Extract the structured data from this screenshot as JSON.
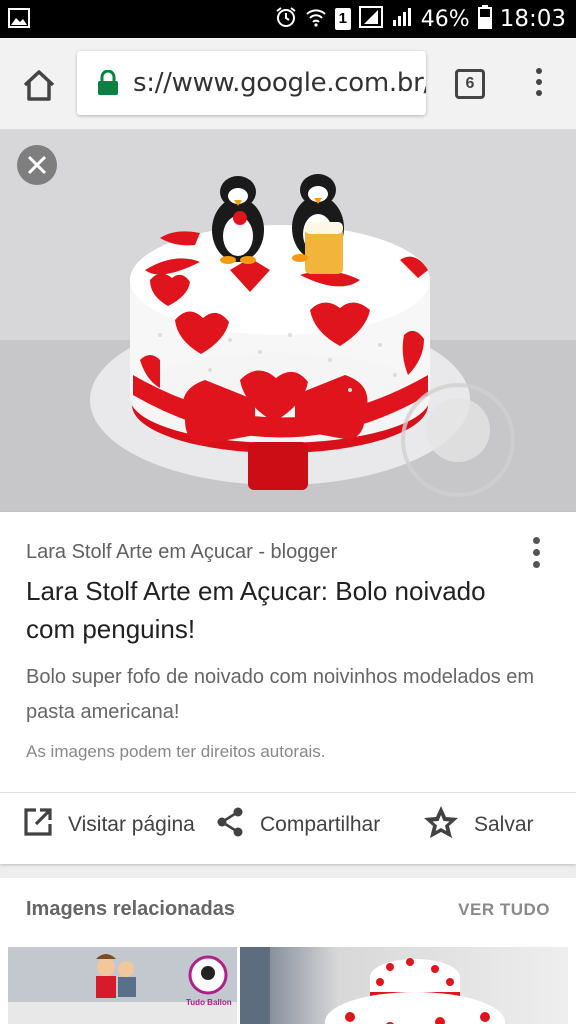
{
  "status_bar": {
    "battery": "46%",
    "time": "18:03",
    "sim_badge": "1"
  },
  "toolbar": {
    "url": "s://www.google.com.br/s",
    "tab_count": "6"
  },
  "result": {
    "source": "Lara Stolf Arte em Açucar - blogger",
    "title": "Lara Stolf Arte em Açucar: Bolo noivado com penguins!",
    "description": "Bolo super fofo de noivado com noivinhos modelados em pasta americana!",
    "copyright": "As imagens podem ter direitos autorais.",
    "actions": {
      "visit": "Visitar página",
      "share": "Compartilhar",
      "save": "Salvar"
    }
  },
  "related": {
    "title": "Imagens relacionadas",
    "see_all": "VER TUDO",
    "thumb1_logo_text": "Tudo Ballon"
  },
  "colors": {
    "lock_green": "#0b8043",
    "cake_red": "#e0141c",
    "text_primary": "#212121",
    "text_secondary": "#616161"
  },
  "icons": [
    "picture-icon",
    "alarm-icon",
    "wifi-icon",
    "signal-icon",
    "battery-icon",
    "home-icon",
    "lock-icon",
    "tabs-icon",
    "overflow-menu-icon",
    "close-icon",
    "open-external-icon",
    "share-icon",
    "star-icon"
  ]
}
